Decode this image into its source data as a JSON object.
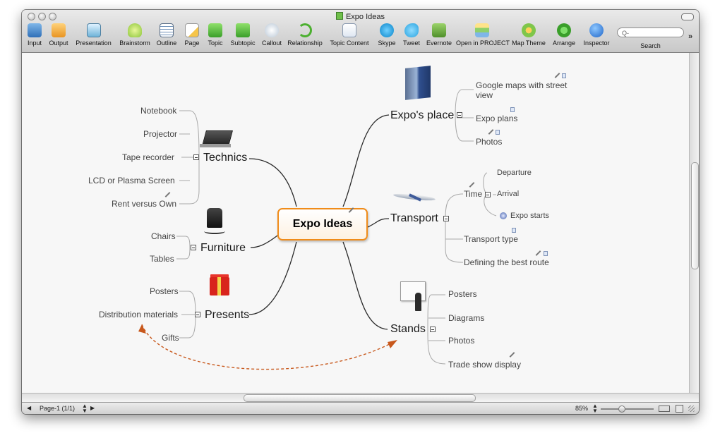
{
  "window": {
    "title": "Expo Ideas"
  },
  "toolbar": {
    "items": [
      {
        "label": "Input",
        "icon": "input-icon"
      },
      {
        "label": "Output",
        "icon": "output-icon"
      },
      {
        "label": "Presentation",
        "icon": "presentation-icon"
      },
      {
        "label": "Brainstorm",
        "icon": "brainstorm-icon"
      },
      {
        "label": "Outline",
        "icon": "outline-icon"
      },
      {
        "label": "Page",
        "icon": "page-icon"
      },
      {
        "label": "Topic",
        "icon": "topic-icon"
      },
      {
        "label": "Subtopic",
        "icon": "subtopic-icon"
      },
      {
        "label": "Callout",
        "icon": "callout-icon"
      },
      {
        "label": "Relationship",
        "icon": "relationship-icon"
      },
      {
        "label": "Topic Content",
        "icon": "topic-content-icon"
      },
      {
        "label": "Skype",
        "icon": "skype-icon"
      },
      {
        "label": "Tweet",
        "icon": "tweet-icon"
      },
      {
        "label": "Evernote",
        "icon": "evernote-icon"
      },
      {
        "label": "Open in PROJECT",
        "icon": "project-icon"
      },
      {
        "label": "Map Theme",
        "icon": "map-theme-icon"
      },
      {
        "label": "Arrange",
        "icon": "arrange-icon"
      },
      {
        "label": "Inspector",
        "icon": "inspector-icon"
      }
    ],
    "search_label": "Search",
    "search_placeholder": "Q-",
    "overflow": "»"
  },
  "map": {
    "central": "Expo Ideas",
    "left": {
      "technics": {
        "label": "Technics",
        "children": [
          "Notebook",
          "Projector",
          "Tape recorder",
          "LCD or Plasma Screen",
          "Rent versus Own"
        ]
      },
      "furniture": {
        "label": "Furniture",
        "children": [
          "Chairs",
          "Tables"
        ]
      },
      "presents": {
        "label": "Presents",
        "children": [
          "Posters",
          "Distribution materials",
          "Gifts"
        ]
      }
    },
    "right": {
      "expos_place": {
        "label": "Expo's place",
        "children": [
          "Google maps with street view",
          "Expo plans",
          "Photos"
        ],
        "child0_line1": "Google maps with street",
        "child0_line2": "view"
      },
      "transport": {
        "label": "Transport",
        "time": "Time",
        "time_children": [
          "Departure",
          "Arrival",
          "Expo starts"
        ],
        "children": [
          "Transport type",
          "Defining the best route"
        ]
      },
      "stands": {
        "label": "Stands",
        "children": [
          "Posters",
          "Diagrams",
          "Photos",
          "Trade show display"
        ]
      }
    }
  },
  "statusbar": {
    "page": "Page-1 (1/1)",
    "zoom": "85%"
  },
  "colors": {
    "central_border": "#f08c1a",
    "relationship_arrow": "#c8581c",
    "branch_line": "#222222"
  }
}
